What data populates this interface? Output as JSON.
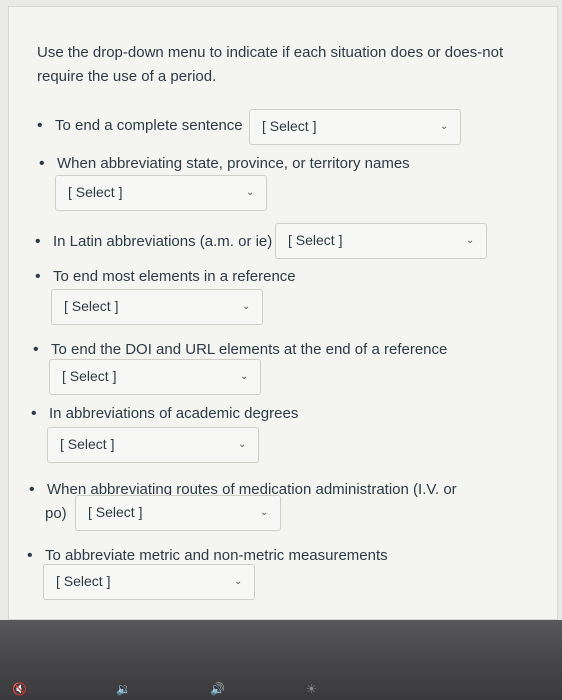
{
  "intro": "Use the drop-down menu to indicate if each situation does or does-not require the use of a period.",
  "items": [
    {
      "bullet": "•",
      "label": "To end a complete sentence",
      "value": "[ Select ]"
    },
    {
      "bullet": "•",
      "label": "When abbreviating state, province, or territory names",
      "value": "[ Select ]"
    },
    {
      "bullet": "•",
      "label": "In Latin abbreviations (a.m. or ie)",
      "value": "[ Select ]"
    },
    {
      "bullet": "•",
      "label": "To end most elements in a reference",
      "value": "[ Select ]"
    },
    {
      "bullet": "•",
      "label": "To end the DOI and URL elements at the end of a reference",
      "value": "[ Select ]"
    },
    {
      "bullet": "•",
      "label": "In abbreviations of academic degrees",
      "value": "[ Select ]"
    },
    {
      "bullet": "•",
      "label_line1": "When abbreviating routes of medication administration (I.V. or",
      "label_line2": "po)",
      "value": "[ Select ]"
    },
    {
      "bullet": "•",
      "label": "To abbreviate metric and non-metric measurements",
      "value": "[ Select ]"
    }
  ],
  "chevron_icon": "chevron-down-icon",
  "colors": {
    "text": "#2d3b45",
    "card": "#f4f4f1",
    "select_bg": "#f7f7f5",
    "border": "#cfcfca"
  }
}
